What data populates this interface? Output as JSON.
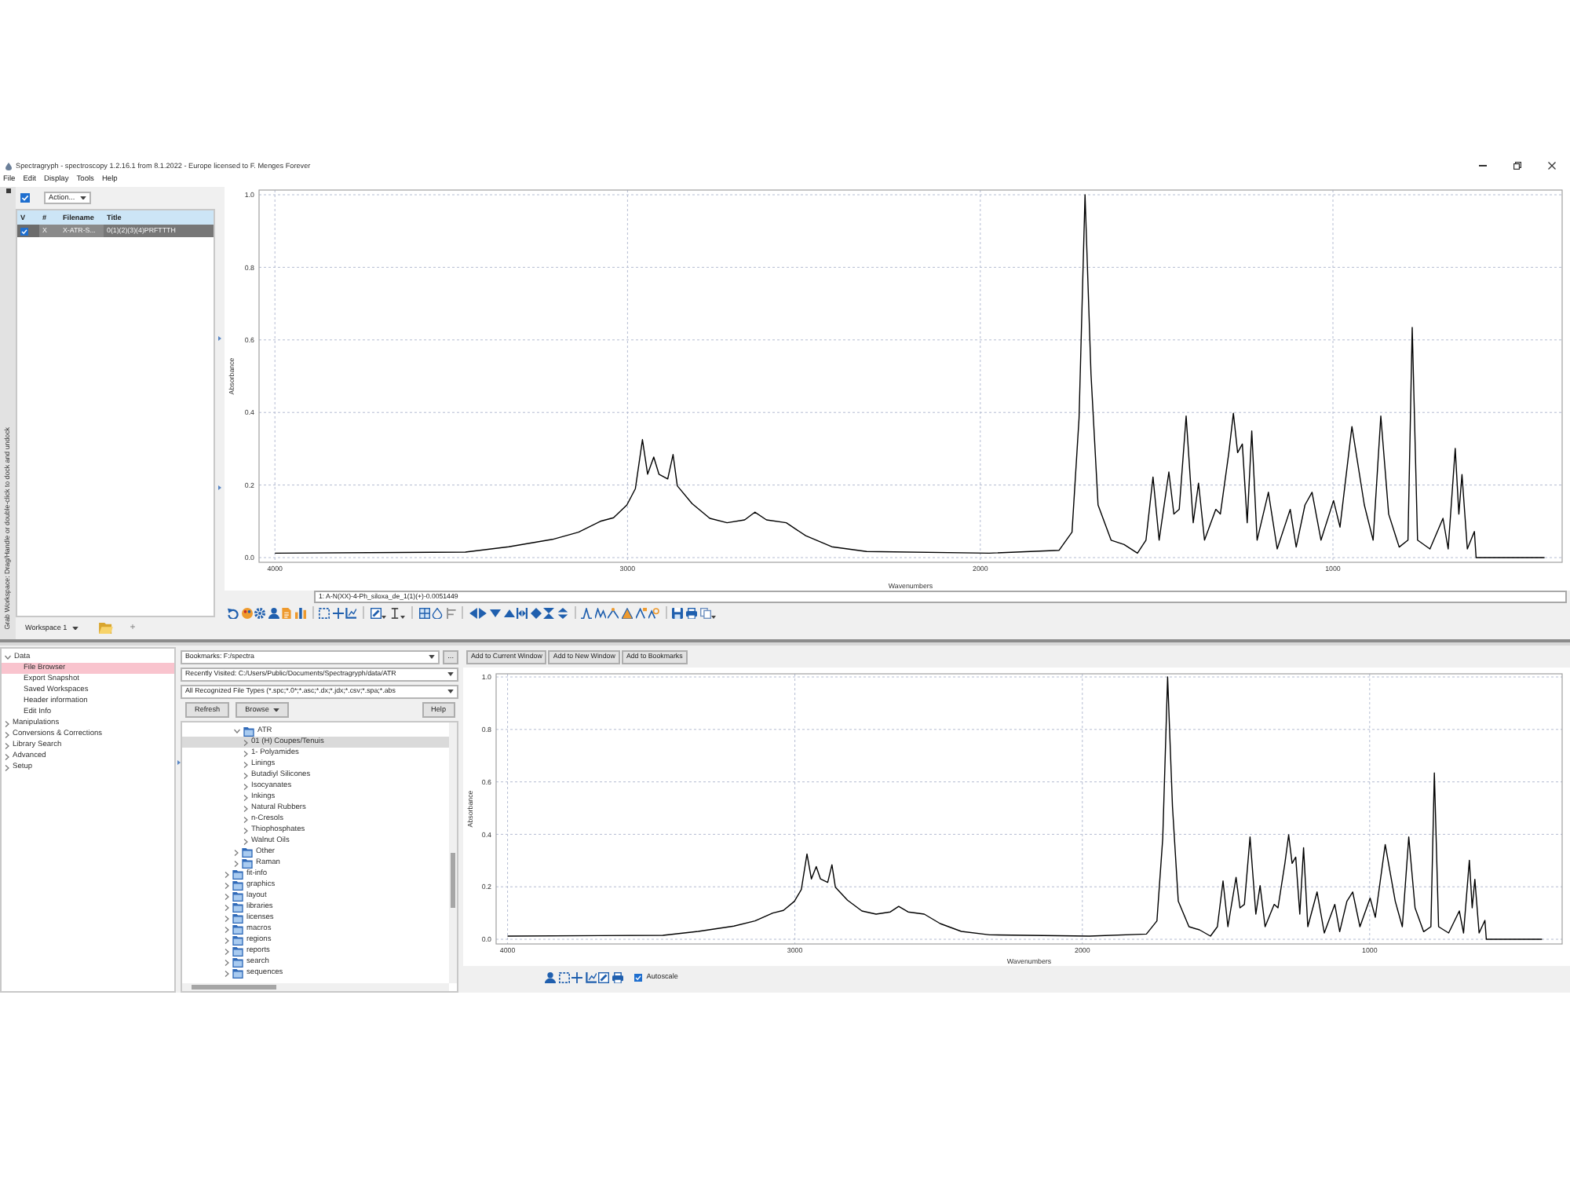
{
  "window": {
    "title": "Spectragryph - spectroscopy 1.2.16.1 from 8.1.2022 - Europe licensed to F. Menges Forever"
  },
  "menu": [
    "File",
    "Edit",
    "Display",
    "Tools",
    "Help"
  ],
  "dock_handle": {
    "label": "Grab Workspace: Drag/Handle or double-click to dock and undock"
  },
  "spectra_list": {
    "select_all": {
      "checked": true
    },
    "action": "Action...",
    "columns": [
      "V",
      "#",
      "Filename",
      "Title"
    ],
    "rows": [
      {
        "checked": true,
        "selected": true,
        "number": "X",
        "filename": "X-ATR-S...",
        "title": "0(1)(2)(3)(4)PRFTTTH"
      }
    ],
    "workspace": "Workspace 1",
    "add": "+"
  },
  "main_plot": {
    "chart_data": {
      "type": "line",
      "xlabel": "Wavenumbers",
      "ylabel": "Absorbance",
      "x": [
        4000,
        3460,
        3337,
        3213,
        3139,
        3077,
        3040,
        3002,
        2978,
        2958,
        2943,
        2926,
        2911,
        2886,
        2871,
        2859,
        2817,
        2767,
        2718,
        2668,
        2639,
        2606,
        2550,
        2495,
        2421,
        2322,
        1975,
        1777,
        1740,
        1720,
        1703,
        1686,
        1666,
        1629,
        1592,
        1554,
        1530,
        1510,
        1493,
        1465,
        1451,
        1436,
        1416,
        1396,
        1381,
        1364,
        1332,
        1319,
        1295,
        1282,
        1270,
        1257,
        1243,
        1230,
        1215,
        1183,
        1158,
        1121,
        1104,
        1079,
        1059,
        1034,
        998,
        980,
        946,
        911,
        886,
        864,
        842,
        812,
        787,
        775,
        760,
        725,
        688,
        673,
        653,
        643,
        634,
        619,
        599,
        594,
        400
      ],
      "series": [
        {
          "color": "#000000",
          "values": [
            0.012,
            0.015,
            0.03,
            0.05,
            0.07,
            0.1,
            0.11,
            0.145,
            0.19,
            0.325,
            0.23,
            0.277,
            0.23,
            0.217,
            0.284,
            0.198,
            0.149,
            0.108,
            0.096,
            0.104,
            0.125,
            0.104,
            0.096,
            0.06,
            0.03,
            0.017,
            0.012,
            0.02,
            0.07,
            0.385,
            1.0,
            0.506,
            0.145,
            0.048,
            0.036,
            0.012,
            0.048,
            0.222,
            0.048,
            0.236,
            0.12,
            0.133,
            0.39,
            0.096,
            0.205,
            0.048,
            0.133,
            0.12,
            0.289,
            0.398,
            0.289,
            0.313,
            0.096,
            0.349,
            0.048,
            0.18,
            0.024,
            0.133,
            0.029,
            0.145,
            0.18,
            0.048,
            0.157,
            0.084,
            0.361,
            0.145,
            0.048,
            0.39,
            0.12,
            0.029,
            0.048,
            0.634,
            0.048,
            0.024,
            0.108,
            0.024,
            0.301,
            0.12,
            0.229,
            0.024,
            0.072,
            0.0,
            0.0
          ]
        }
      ],
      "xlim": [
        4045,
        350
      ],
      "ylim": [
        -0.013,
        1.013
      ],
      "xticks": [
        4000,
        3000,
        2000,
        1000
      ],
      "yticks": [
        {
          "value": 0,
          "label": "0.0"
        },
        {
          "value": 0.2,
          "label": "0.2"
        },
        {
          "value": 0.4,
          "label": "0.4"
        },
        {
          "value": 0.6,
          "label": "0.6"
        },
        {
          "value": 0.8,
          "label": "0.8"
        },
        {
          "value": 1,
          "label": "1.0"
        }
      ],
      "grid": true
    },
    "info": "1: A-N(XX)-4-Ph_siloxa_de_1(1)(+)-0.0051449"
  },
  "nav_tree": {
    "items": [
      {
        "label": "Data",
        "expanded": true,
        "selected": false,
        "children": [
          {
            "label": "File Browser",
            "selected": true
          },
          {
            "label": "Export Snapshot",
            "selected": false
          },
          {
            "label": "Saved Workspaces",
            "selected": false
          },
          {
            "label": "Header information",
            "selected": false
          },
          {
            "label": "Edit Info",
            "selected": false
          }
        ]
      },
      {
        "label": "Manipulations",
        "expanded": false,
        "selected": false
      },
      {
        "label": "Conversions & Corrections",
        "expanded": false,
        "selected": false
      },
      {
        "label": "Library Search",
        "expanded": false,
        "selected": false
      },
      {
        "label": "Advanced",
        "expanded": false,
        "selected": false
      },
      {
        "label": "Setup",
        "expanded": false,
        "selected": false
      }
    ]
  },
  "file_browser": {
    "bookmarks": "Bookmarks: F:/spectra",
    "more": "...",
    "recent": "Recently Visited: C:/Users/Public/Documents/Spectragryph/data/ATR",
    "filter": "All Recognized File Types (*.spc;*.0*;*.asc;*.dx;*.jdx;*.csv;*.spa;*.abs",
    "buttons": [
      "Refresh",
      "Browse"
    ],
    "help": "Help",
    "tree": [
      {
        "children": [
          {
            "label": "ATR",
            "kind": "folder",
            "expanded": true,
            "selected": false,
            "children": [
              {
                "label": "01 (H) Coupes/Tenuis",
                "expanded": false,
                "selected": true
              },
              {
                "label": "1- Polyamides",
                "expanded": false,
                "selected": false
              },
              {
                "label": "Linings",
                "expanded": false,
                "selected": false
              },
              {
                "label": "Butadiyl Silicones",
                "expanded": false,
                "selected": false
              },
              {
                "label": "Isocyanates",
                "expanded": false,
                "selected": false
              },
              {
                "label": "Inkings",
                "expanded": false,
                "selected": false
              },
              {
                "label": "Natural Rubbers",
                "expanded": false,
                "selected": false
              },
              {
                "label": "n-Cresols",
                "expanded": false,
                "selected": false
              },
              {
                "label": "Thiophosphates",
                "expanded": false,
                "selected": false
              },
              {
                "label": "Walnut Oils",
                "expanded": false,
                "selected": false
              }
            ]
          },
          {
            "label": "Other",
            "kind": "folder",
            "expanded": false,
            "selected": false
          },
          {
            "label": "Raman",
            "kind": "folder",
            "expanded": false,
            "selected": false
          }
        ]
      },
      {
        "label": "fit-info",
        "kind": "folder",
        "expanded": false,
        "selected": false
      },
      {
        "label": "graphics",
        "kind": "folder",
        "expanded": false,
        "selected": false
      },
      {
        "label": "layout",
        "kind": "folder",
        "expanded": false,
        "selected": false
      },
      {
        "label": "libraries",
        "kind": "folder",
        "expanded": false,
        "selected": false
      },
      {
        "label": "licenses",
        "kind": "folder",
        "expanded": false,
        "selected": false
      },
      {
        "label": "macros",
        "kind": "folder",
        "expanded": false,
        "selected": false
      },
      {
        "label": "regions",
        "kind": "folder",
        "expanded": false,
        "selected": false
      },
      {
        "label": "reports",
        "kind": "folder",
        "expanded": false,
        "selected": false
      },
      {
        "label": "search",
        "kind": "folder",
        "expanded": false,
        "selected": false
      },
      {
        "label": "sequences",
        "kind": "folder",
        "expanded": false,
        "selected": false
      }
    ]
  },
  "preview": {
    "buttons": [
      "Add to Current Window",
      "Add to New Window",
      "Add to Bookmarks"
    ],
    "chart_data": {
      "type": "line",
      "xlabel": "Wavenumbers",
      "ylabel": "Absorbance",
      "x": [
        4000,
        3460,
        3337,
        3213,
        3139,
        3077,
        3040,
        3002,
        2978,
        2958,
        2943,
        2926,
        2911,
        2886,
        2871,
        2859,
        2817,
        2767,
        2718,
        2668,
        2639,
        2606,
        2550,
        2495,
        2421,
        2322,
        1975,
        1777,
        1740,
        1720,
        1703,
        1686,
        1666,
        1629,
        1592,
        1554,
        1530,
        1510,
        1493,
        1465,
        1451,
        1436,
        1416,
        1396,
        1381,
        1364,
        1332,
        1319,
        1295,
        1282,
        1270,
        1257,
        1243,
        1230,
        1215,
        1183,
        1158,
        1121,
        1104,
        1079,
        1059,
        1034,
        998,
        980,
        946,
        911,
        886,
        864,
        842,
        812,
        787,
        775,
        760,
        725,
        688,
        673,
        653,
        643,
        634,
        619,
        599,
        594,
        400
      ],
      "series": [
        {
          "color": "#000000",
          "values": [
            0.012,
            0.015,
            0.03,
            0.05,
            0.07,
            0.1,
            0.11,
            0.145,
            0.19,
            0.325,
            0.23,
            0.277,
            0.23,
            0.217,
            0.284,
            0.198,
            0.149,
            0.108,
            0.096,
            0.104,
            0.125,
            0.104,
            0.096,
            0.06,
            0.03,
            0.017,
            0.012,
            0.02,
            0.07,
            0.385,
            1.0,
            0.506,
            0.145,
            0.048,
            0.036,
            0.012,
            0.048,
            0.222,
            0.048,
            0.236,
            0.12,
            0.133,
            0.39,
            0.096,
            0.205,
            0.048,
            0.133,
            0.12,
            0.289,
            0.398,
            0.289,
            0.313,
            0.096,
            0.349,
            0.048,
            0.18,
            0.024,
            0.133,
            0.029,
            0.145,
            0.18,
            0.048,
            0.157,
            0.084,
            0.361,
            0.145,
            0.048,
            0.39,
            0.12,
            0.029,
            0.048,
            0.634,
            0.048,
            0.024,
            0.108,
            0.024,
            0.301,
            0.12,
            0.229,
            0.024,
            0.072,
            0.0,
            0.0
          ]
        }
      ],
      "xlim": [
        4040,
        330
      ],
      "ylim": [
        -0.018,
        1.012
      ],
      "xticks": [
        4000,
        3000,
        2000,
        1000
      ],
      "yticks": [
        {
          "value": 0,
          "label": "0.0"
        },
        {
          "value": 0.2,
          "label": "0.2"
        },
        {
          "value": 0.4,
          "label": "0.4"
        },
        {
          "value": 0.6,
          "label": "0.6"
        },
        {
          "value": 0.8,
          "label": "0.8"
        },
        {
          "value": 1,
          "label": "1.0"
        }
      ],
      "grid": true
    },
    "autoscale": {
      "label": "Autoscale",
      "checked": true
    }
  }
}
